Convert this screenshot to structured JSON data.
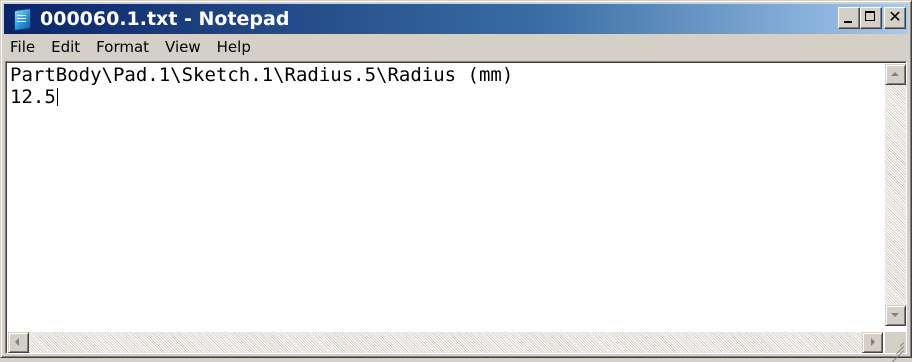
{
  "window": {
    "title": "000060.1.txt - Notepad",
    "app_icon": "notepad-icon",
    "caption_buttons": {
      "minimize_icon": "minimize-icon",
      "maximize_icon": "maximize-icon",
      "close_icon": "close-icon"
    }
  },
  "menubar": {
    "items": [
      {
        "label": "File"
      },
      {
        "label": "Edit"
      },
      {
        "label": "Format"
      },
      {
        "label": "View"
      },
      {
        "label": "Help"
      }
    ]
  },
  "editor": {
    "lines": [
      "PartBody\\Pad.1\\Sketch.1\\Radius.5\\Radius (mm)",
      "12.5"
    ]
  },
  "colors": {
    "titlebar_start": "#0a246a",
    "titlebar_end": "#a6caf0",
    "chrome": "#d4d0c8",
    "editor_bg": "#ffffff"
  }
}
